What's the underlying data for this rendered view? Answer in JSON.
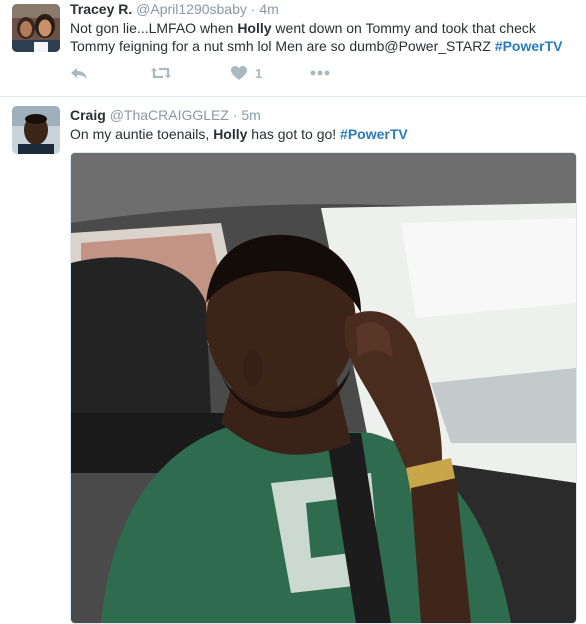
{
  "tweets": [
    {
      "name": "Tracey R.",
      "handle": "@April1290sbaby",
      "separator": "·",
      "time": "4m",
      "text_parts": [
        "Not gon lie...LMFAO when ",
        "Holly",
        " went down on Tommy and took that check Tommy feigning for a nut smh lol Men are so dumb@Power_STARZ ",
        "#PowerTV"
      ],
      "actions": {
        "reply_icon": "reply-icon",
        "retweet_icon": "retweet-icon",
        "like_icon": "heart-icon",
        "like_count": "1",
        "more_icon": "more-icon"
      }
    },
    {
      "name": "Craig",
      "handle": "@ThaCRAIGGLEZ",
      "separator": "·",
      "time": "5m",
      "text_parts": [
        "On my auntie toenails, ",
        "Holly",
        " has got to go! ",
        "#PowerTV"
      ]
    }
  ],
  "colors": {
    "link": "#2b7bb9",
    "meta": "#8899a6",
    "text": "#292f33",
    "action": "#aab8c2"
  }
}
